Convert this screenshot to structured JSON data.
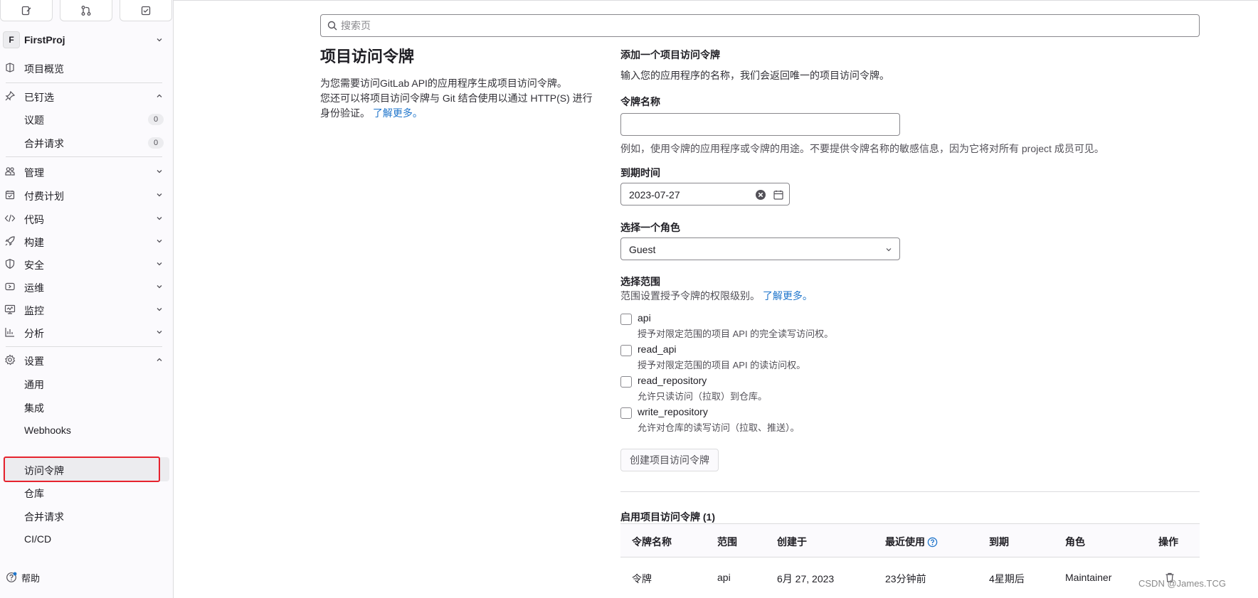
{
  "sidebar": {
    "project": {
      "avatar": "F",
      "name": "FirstProj"
    },
    "items": {
      "overview": "项目概览",
      "pinned": "已钉选",
      "issues": "议题",
      "issues_count": "0",
      "merge_requests": "合并请求",
      "mr_count": "0",
      "manage": "管理",
      "plan": "付费计划",
      "code": "代码",
      "build": "构建",
      "secure": "安全",
      "deploy": "运维",
      "monitor": "监控",
      "analyze": "分析",
      "settings": "设置",
      "general": "通用",
      "integrations": "集成",
      "webhooks": "Webhooks",
      "access_tokens": "访问令牌",
      "repository": "仓库",
      "settings_mr": "合并请求",
      "cicd": "CI/CD"
    },
    "help": "帮助"
  },
  "search": {
    "placeholder": "搜索页"
  },
  "left": {
    "title": "项目访问令牌",
    "desc_line1": "为您需要访问GitLab API的应用程序生成项目访问令牌。",
    "desc_line2": "您还可以将项目访问令牌与 Git 结合使用以通过 HTTP(S) 进行身份验证。",
    "learn_more": "了解更多。"
  },
  "form": {
    "heading": "添加一个项目访问令牌",
    "intro": "输入您的应用程序的名称，我们会返回唯一的项目访问令牌。",
    "token_name_label": "令牌名称",
    "token_name_value": "",
    "token_name_help": "例如，使用令牌的应用程序或令牌的用途。不要提供令牌名称的敏感信息，因为它将对所有 project 成员可见。",
    "expiry_label": "到期时间",
    "expiry_value": "2023-07-27",
    "role_label": "选择一个角色",
    "role_value": "Guest",
    "scopes_label": "选择范围",
    "scopes_help": "范围设置授予令牌的权限级别。",
    "scopes_learn_more": "了解更多。",
    "scopes": [
      {
        "name": "api",
        "desc": "授予对限定范围的项目 API 的完全读写访问权。",
        "checked": false
      },
      {
        "name": "read_api",
        "desc": "授予对限定范围的项目 API 的读访问权。",
        "checked": false
      },
      {
        "name": "read_repository",
        "desc": "允许只读访问（拉取）到仓库。",
        "checked": false
      },
      {
        "name": "write_repository",
        "desc": "允许对仓库的读写访问（拉取、推送）。",
        "checked": false
      }
    ],
    "create_button": "创建项目访问令牌"
  },
  "table": {
    "title": "启用项目访问令牌 (1)",
    "headers": [
      "令牌名称",
      "范围",
      "创建于",
      "最近使用",
      "到期",
      "角色",
      "操作"
    ],
    "rows": [
      [
        "令牌",
        "api",
        "6月 27, 2023",
        "23分钟前",
        "4星期后",
        "Maintainer"
      ]
    ]
  },
  "watermark": "CSDN @James.TCG",
  "colors": {
    "accent": "#1f75cb",
    "highlight": "#e6232e"
  }
}
